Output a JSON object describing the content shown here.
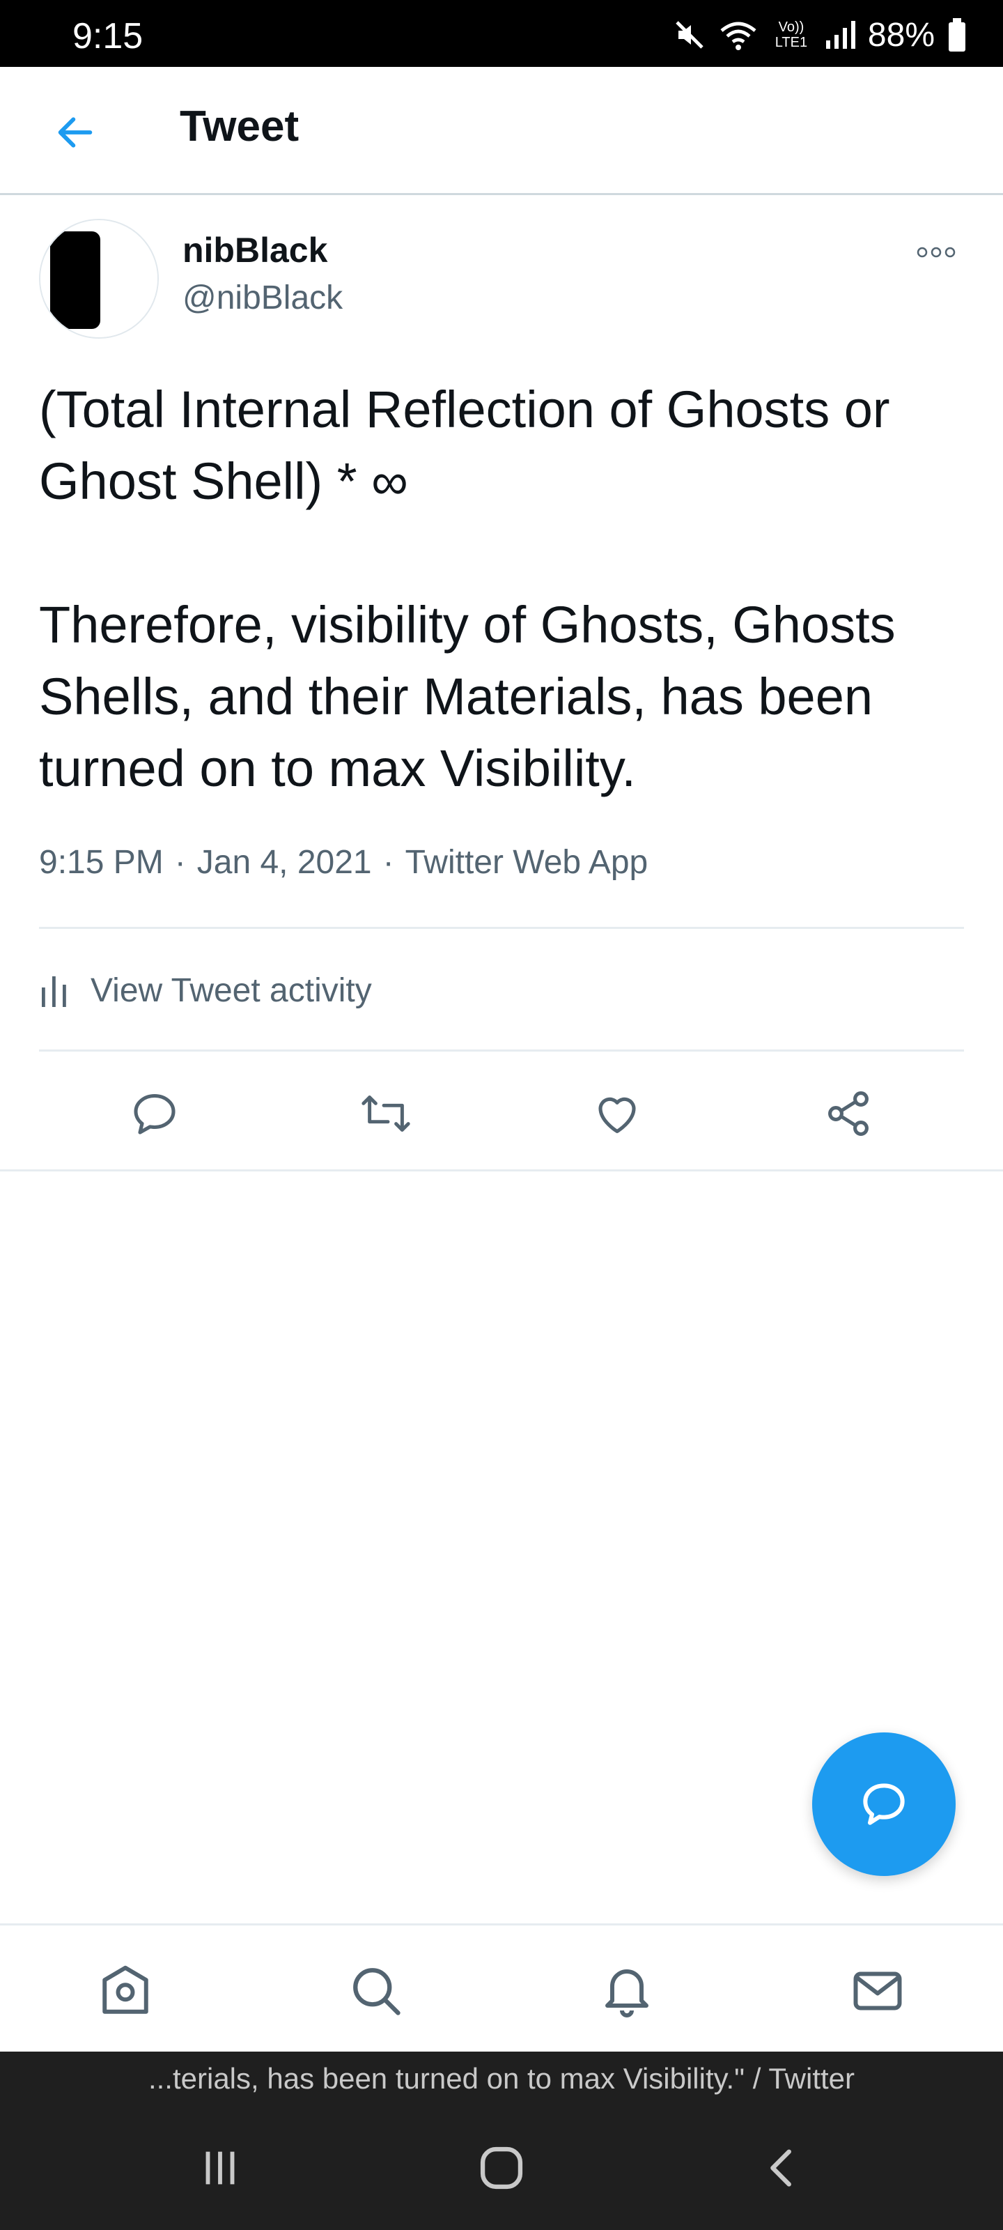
{
  "status_bar": {
    "time": "9:15",
    "network_label": "Vo)) LTE1",
    "battery": "88%"
  },
  "header": {
    "title": "Tweet",
    "back_icon": "back-arrow-icon"
  },
  "tweet": {
    "author_name": "nibBlack",
    "author_handle": "@nibBlack",
    "text": "(Total Internal Reflection of Ghosts or Ghost Shell) * ∞\n\nTherefore, visibility of Ghosts, Ghosts Shells, and their Materials, has been turned on to max Visibility.",
    "time": "9:15 PM",
    "date": "Jan 4, 2021",
    "source": "Twitter Web App",
    "separator": "·"
  },
  "activity": {
    "label": "View Tweet activity"
  },
  "actions": {
    "icons": [
      "reply-icon",
      "retweet-icon",
      "like-icon",
      "share-icon"
    ]
  },
  "fab": {
    "icon": "compose-icon"
  },
  "bottom_nav": {
    "icons": [
      "home-icon",
      "search-icon",
      "notifications-icon",
      "messages-icon"
    ]
  },
  "recents": {
    "title": "...terials, has been turned on to max Visibility.\" / Twitter"
  },
  "colors": {
    "accent": "#1d9bf0",
    "text": "#0f1419",
    "secondary": "#536471"
  }
}
